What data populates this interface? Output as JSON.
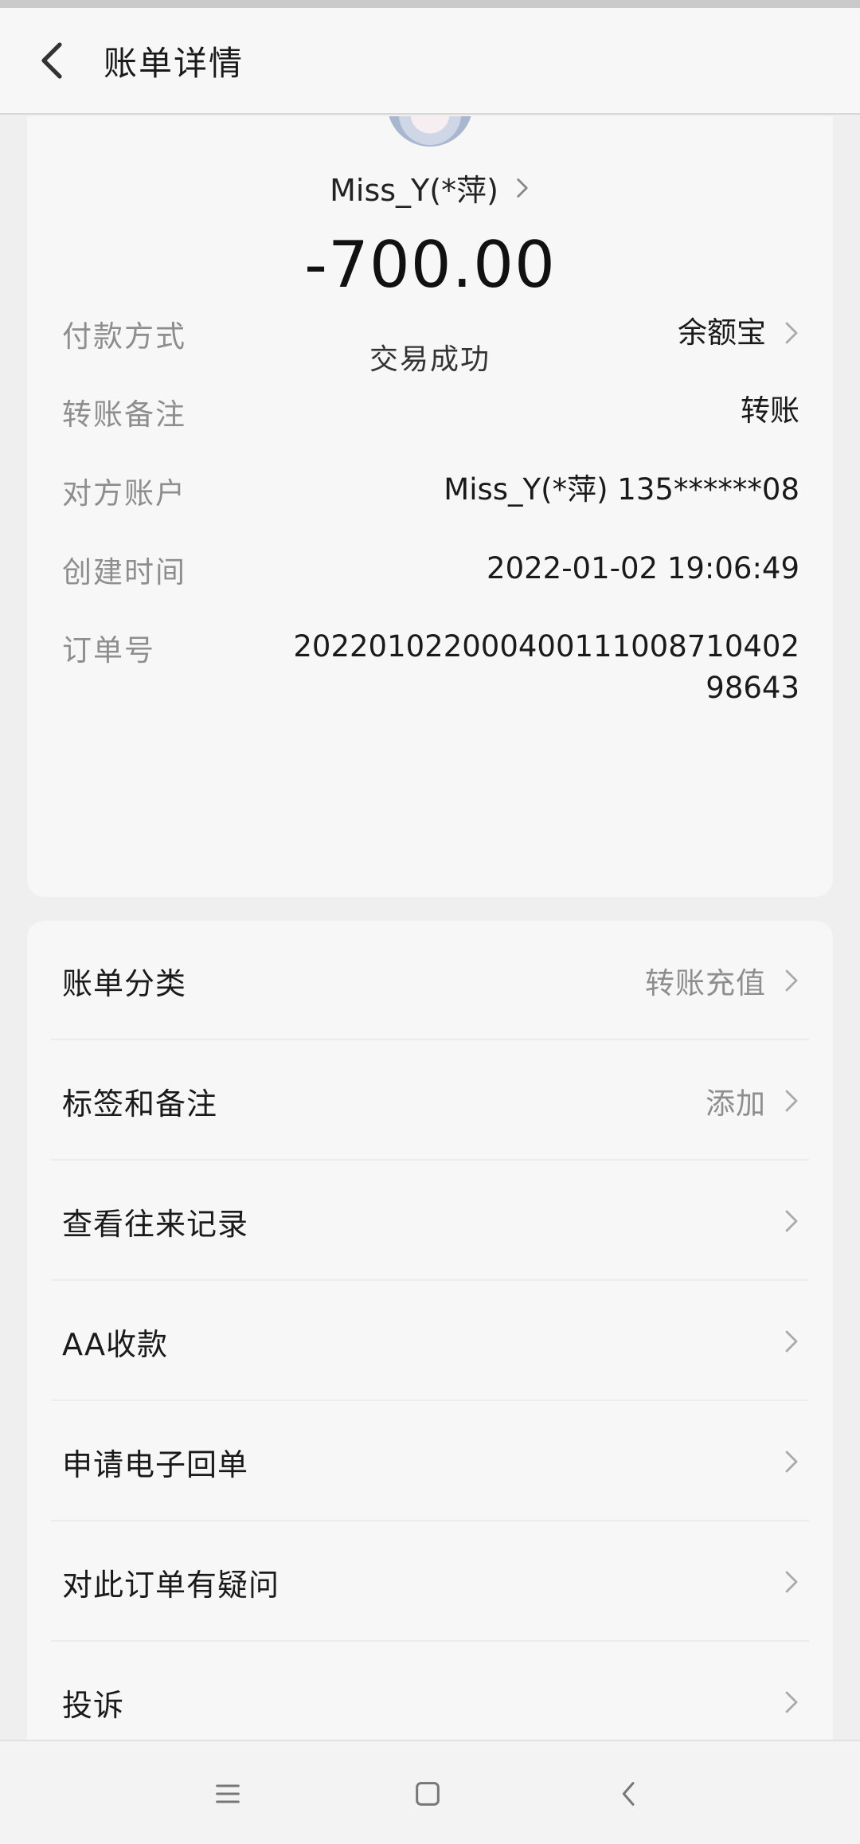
{
  "header": {
    "title": "账单详情",
    "back_icon": "chevron-left-icon"
  },
  "summary": {
    "payee_name": "Miss_Y(*萍)",
    "amount": "-700.00",
    "status": "交易成功"
  },
  "details": [
    {
      "label": "付款方式",
      "value": "余额宝",
      "has_chevron": true
    },
    {
      "label": "转账备注",
      "value": "转账",
      "has_chevron": false
    },
    {
      "label": "对方账户",
      "value": "Miss_Y(*萍) 135******08",
      "has_chevron": false
    },
    {
      "label": "创建时间",
      "value": "2022-01-02 19:06:49",
      "has_chevron": false
    },
    {
      "label": "订单号",
      "value": "20220102200040011100871040298643",
      "has_chevron": false
    }
  ],
  "menu": [
    {
      "label": "账单分类",
      "value": "转账充值"
    },
    {
      "label": "标签和备注",
      "value": "添加"
    },
    {
      "label": "查看往来记录",
      "value": ""
    },
    {
      "label": "AA收款",
      "value": ""
    },
    {
      "label": "申请电子回单",
      "value": ""
    },
    {
      "label": "对此订单有疑问",
      "value": ""
    },
    {
      "label": "投诉",
      "value": ""
    }
  ],
  "navbar": {
    "items": [
      "menu-icon",
      "home-square-icon",
      "back-triangle-icon"
    ]
  },
  "colors": {
    "background": "#efefef",
    "card": "#f7f7f7",
    "muted_text": "#8e8e8e",
    "primary_text": "#1a1a1a"
  }
}
